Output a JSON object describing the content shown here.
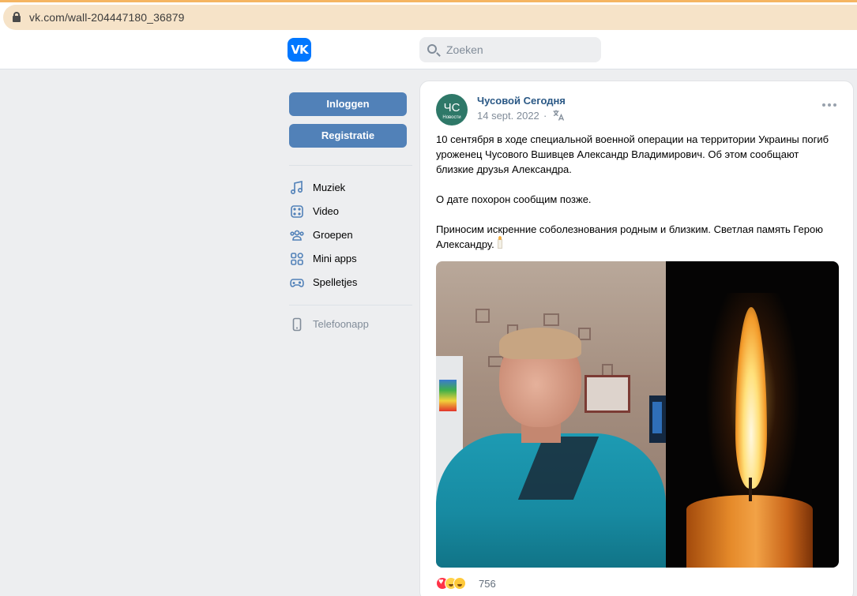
{
  "browser": {
    "url": "vk.com/wall-204447180_36879"
  },
  "header": {
    "logo_text": "VK",
    "search_placeholder": "Zoeken"
  },
  "sidebar": {
    "login_label": "Inloggen",
    "register_label": "Registratie",
    "items": [
      {
        "label": "Muziek",
        "icon": "music-icon"
      },
      {
        "label": "Video",
        "icon": "video-icon"
      },
      {
        "label": "Groepen",
        "icon": "groups-icon"
      },
      {
        "label": "Mini apps",
        "icon": "mini-apps-icon"
      },
      {
        "label": "Spelletjes",
        "icon": "games-icon"
      }
    ],
    "phone_app": {
      "label": "Telefoonapp",
      "icon": "phone-icon"
    }
  },
  "post": {
    "avatar_text": "ЧС",
    "avatar_subtext": "Новости",
    "author": "Чусовой Сегодня",
    "date": "14 sept. 2022",
    "paragraphs": [
      "10 сентября в ходе специальной военной операции на территории Украины погиб уроженец Чусового Вшивцев Александр Владимирович. Об этом сообщают близкие друзья Александра.",
      "О дате похорон сообщим позже.",
      "Приносим искренние соболезнования родным и близким. Светлая память Герою Александру."
    ],
    "reactions": {
      "count": "756",
      "types": [
        "heart",
        "sad",
        "laugh"
      ]
    }
  },
  "colors": {
    "vk_blue": "#0077ff",
    "button_blue": "#5181b8",
    "link_blue": "#2a5885",
    "page_bg": "#edeef0"
  }
}
